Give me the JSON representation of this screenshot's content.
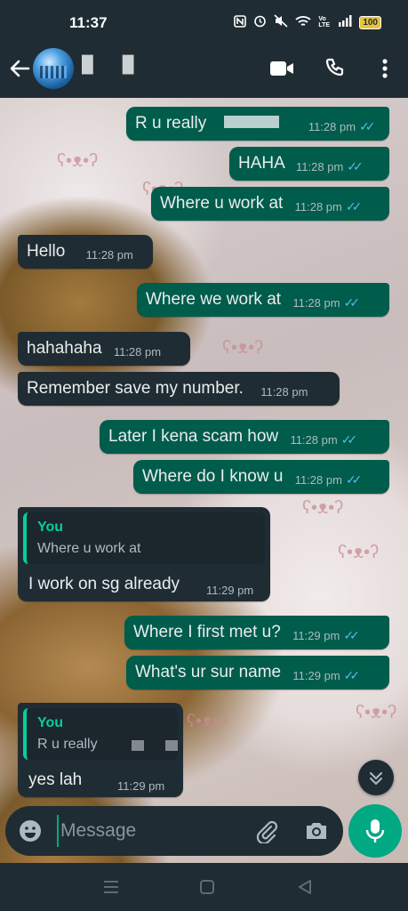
{
  "status_bar": {
    "time": "11:37",
    "battery": "100",
    "network_label": "Vo LTE"
  },
  "header": {
    "contact_name": "█ █"
  },
  "messages": [
    {
      "type": "outgoing",
      "text": "R u really",
      "time": "11:28 pm",
      "status": "read"
    },
    {
      "type": "outgoing",
      "text": "HAHA",
      "time": "11:28 pm",
      "status": "read"
    },
    {
      "type": "outgoing",
      "text": "Where u work at",
      "time": "11:28 pm",
      "status": "read"
    },
    {
      "type": "incoming",
      "text": "Hello",
      "time": "11:28 pm"
    },
    {
      "type": "outgoing",
      "text": "Where we work at",
      "time": "11:28 pm",
      "status": "read"
    },
    {
      "type": "incoming",
      "text": "hahahaha",
      "time": "11:28 pm"
    },
    {
      "type": "incoming",
      "text": "Remember save my number.",
      "time": "11:28 pm"
    },
    {
      "type": "outgoing",
      "text": "Later I kena scam how",
      "time": "11:28 pm",
      "status": "read"
    },
    {
      "type": "outgoing",
      "text": "Where do I know u",
      "time": "11:28 pm",
      "status": "read"
    },
    {
      "type": "incoming_reply",
      "quote_author": "You",
      "quote_text": "Where u work at",
      "text": "I work on sg already",
      "time": "11:29 pm"
    },
    {
      "type": "outgoing",
      "text": "Where I first met u?",
      "time": "11:29 pm",
      "status": "read"
    },
    {
      "type": "outgoing",
      "text": "What's ur sur name",
      "time": "11:29 pm",
      "status": "read"
    },
    {
      "type": "incoming_reply",
      "quote_author": "You",
      "quote_text": "R u really",
      "text": "yes lah",
      "time": "11:29 pm"
    }
  ],
  "compose": {
    "placeholder": "Message"
  },
  "colors": {
    "outgoing_bubble": "#005c4b",
    "incoming_bubble": "#202c33",
    "accent": "#00a884",
    "read_ticks": "#53bdeb",
    "app_bar": "#1f2c34"
  },
  "icons": [
    "back-arrow-icon",
    "video-call-icon",
    "voice-call-icon",
    "more-options-icon",
    "emoji-icon",
    "attach-icon",
    "camera-icon",
    "mic-icon",
    "scroll-down-icon",
    "nav-menu-icon",
    "nav-home-icon",
    "nav-back-icon"
  ]
}
